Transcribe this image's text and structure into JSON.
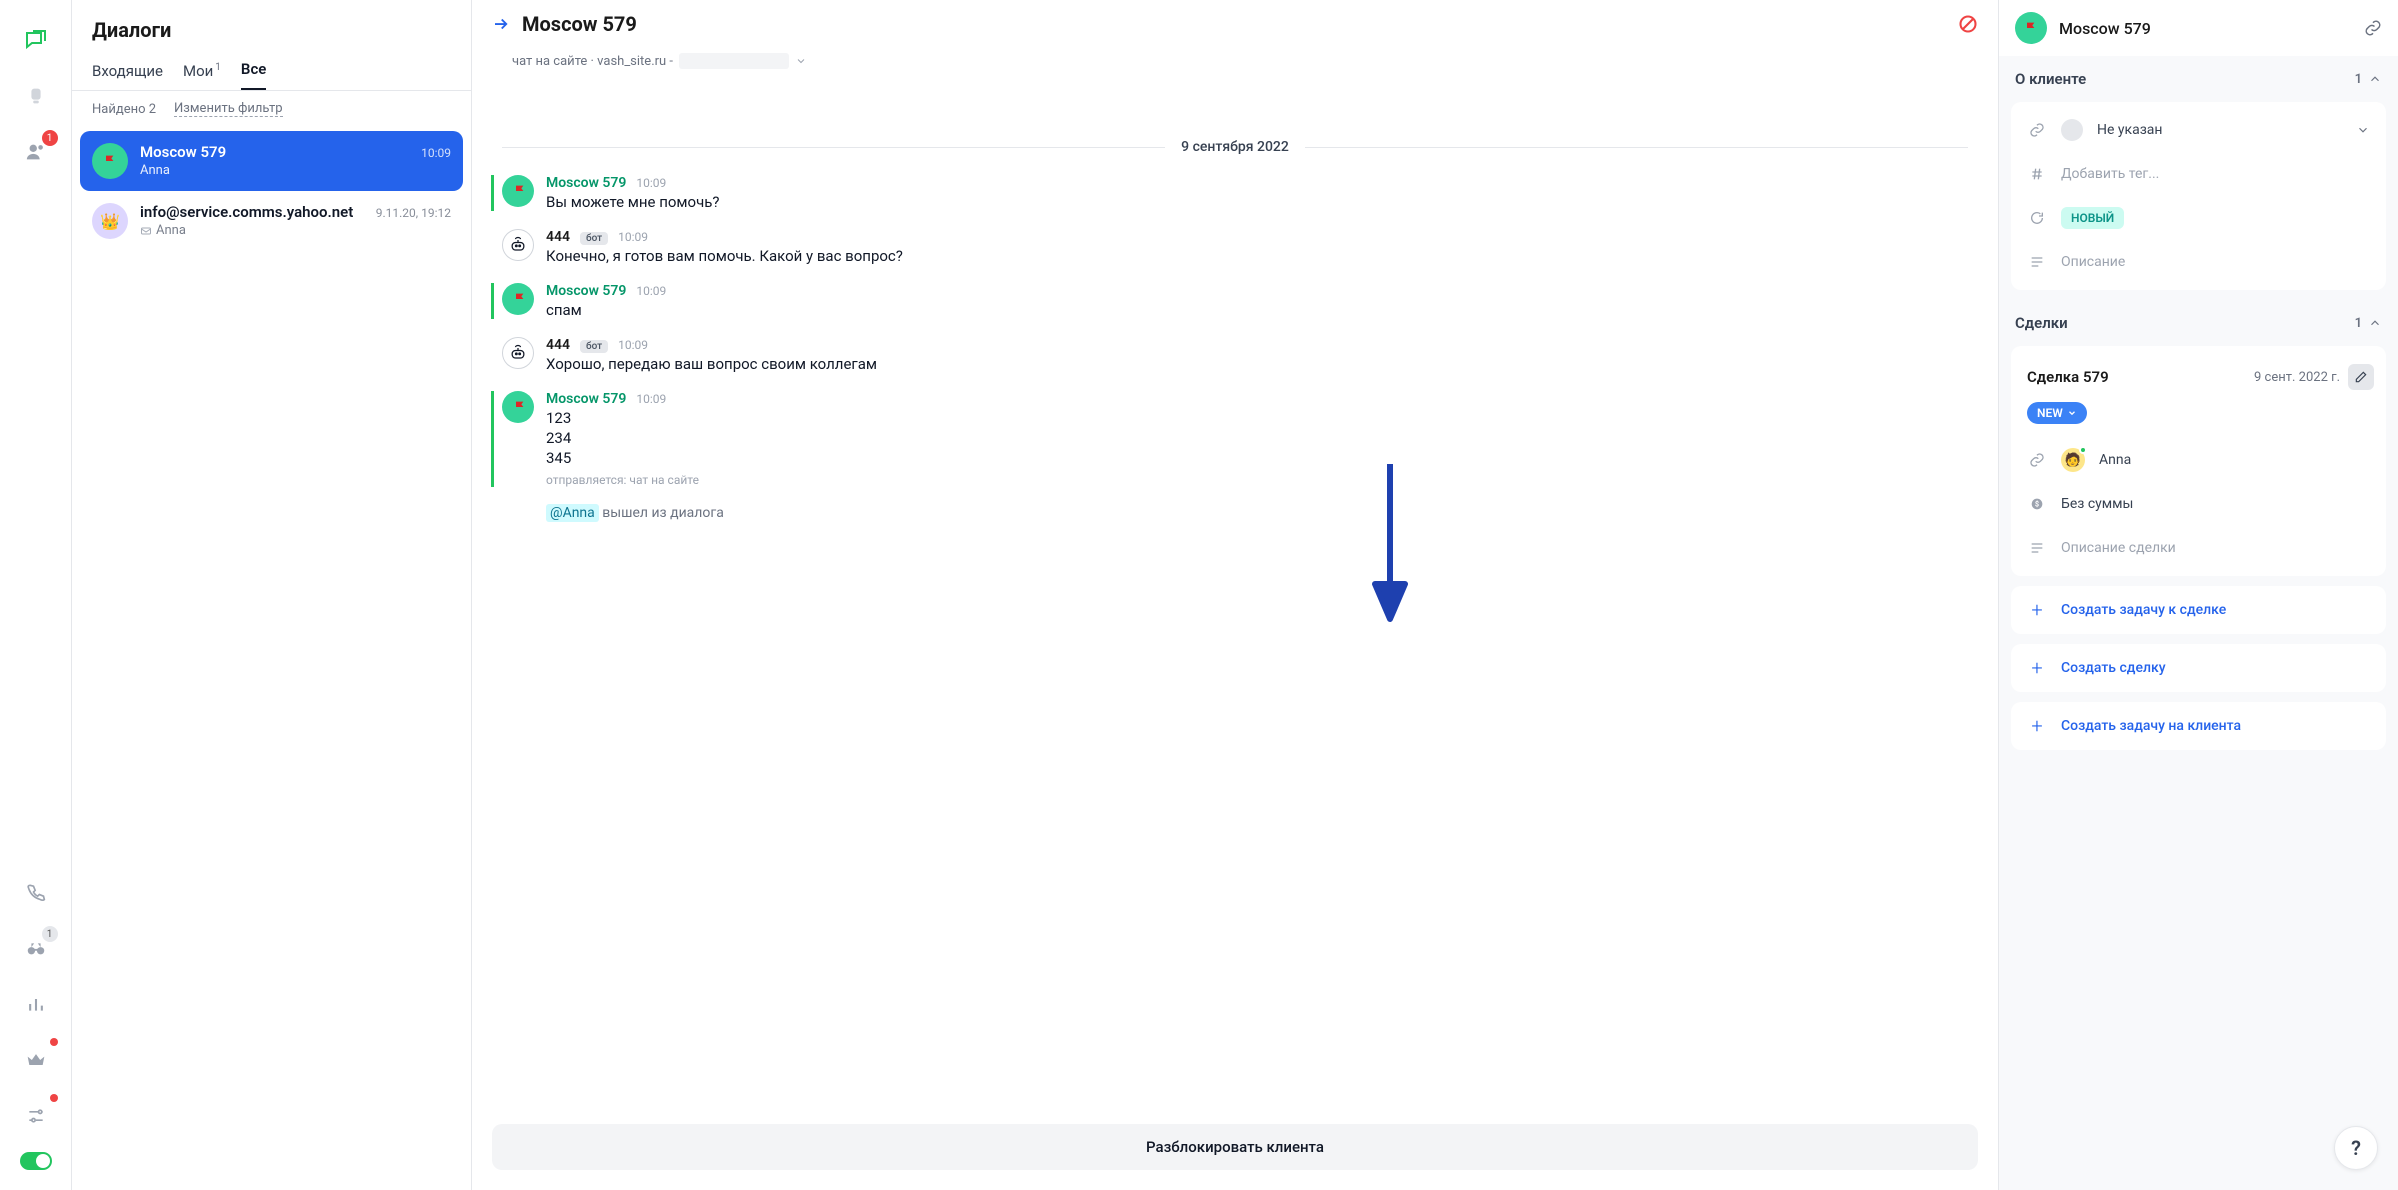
{
  "dialogs": {
    "title": "Диалоги",
    "tabs": {
      "inbox": "Входящие",
      "mine": "Мои",
      "mine_count": "1",
      "all": "Все"
    },
    "found": "Найдено 2",
    "edit_filter": "Изменить фильтр",
    "items": [
      {
        "name": "Moscow 579",
        "sub": "Anna",
        "time": "10:09"
      },
      {
        "name": "info@service.comms.yahoo.net",
        "sub": "Anna",
        "time": "9.11.20, 19:12"
      }
    ]
  },
  "nav": {
    "contacts_badge": "1",
    "binoc_badge": "1"
  },
  "convo": {
    "title": "Moscow 579",
    "source": "чат на сайте · vash_site.ru -",
    "date": "9 сентября 2022",
    "messages": [
      {
        "kind": "client",
        "name": "Moscow 579",
        "time": "10:09",
        "text": "Вы можете мне помочь?"
      },
      {
        "kind": "bot",
        "name": "444",
        "bot_label": "бот",
        "time": "10:09",
        "text": "Конечно, я готов вам помочь. Какой у вас вопрос?"
      },
      {
        "kind": "client",
        "name": "Moscow 579",
        "time": "10:09",
        "text": "спам"
      },
      {
        "kind": "bot",
        "name": "444",
        "bot_label": "бот",
        "time": "10:09",
        "text": "Хорошо, передаю ваш вопрос своим коллегам"
      },
      {
        "kind": "client",
        "name": "Moscow 579",
        "time": "10:09",
        "lines": [
          "123",
          "234",
          "345"
        ],
        "meta": "отправляется: чат на сайте"
      }
    ],
    "system": {
      "mention": "@Anna",
      "text": " вышел из диалога"
    },
    "unblock": "Разблокировать клиента"
  },
  "client": {
    "name": "Moscow 579",
    "about_h": "О клиенте",
    "about_count": "1",
    "employee_placeholder": "Не указан",
    "tag_placeholder": "Добавить тег...",
    "status_chip": "НОВЫЙ",
    "desc_placeholder": "Описание",
    "deals_h": "Сделки",
    "deals_count": "1",
    "deal": {
      "name": "Сделка 579",
      "date": "9 сент. 2022 г.",
      "status": "NEW",
      "owner": "Anna",
      "amount": "Без суммы",
      "desc_placeholder": "Описание сделки"
    },
    "actions": {
      "task_deal": "Создать задачу к сделке",
      "create_deal": "Создать сделку",
      "task_client": "Создать задачу на клиента"
    }
  },
  "help": "?"
}
